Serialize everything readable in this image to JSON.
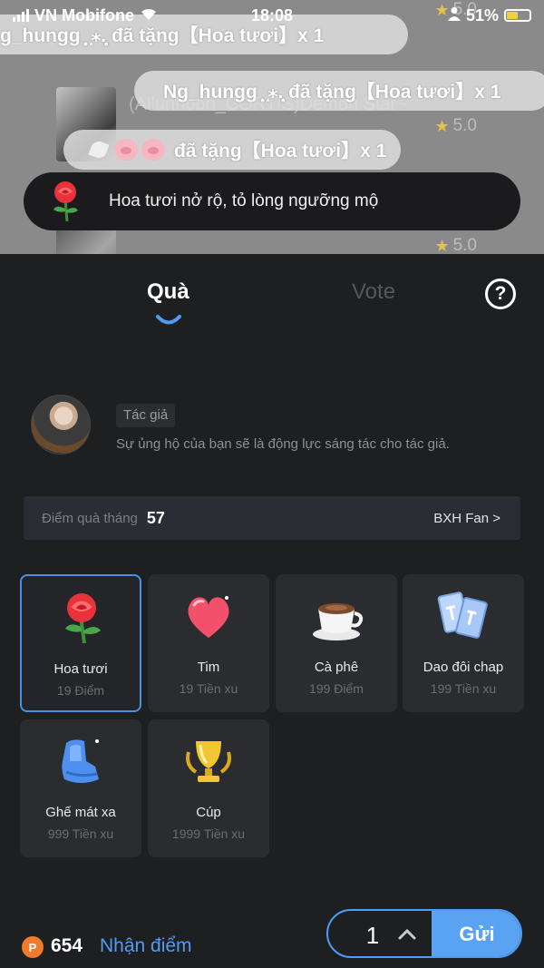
{
  "status_bar": {
    "carrier": "VN Mobifone",
    "time": "18:08",
    "battery": "51%",
    "battery_level": 0.51
  },
  "background": {
    "rating_top": "5.0",
    "title": "(Allunhbon_CORTIS)Demon Star~",
    "rating_1": "5.0",
    "rating_2": "5.0"
  },
  "notifications": [
    {
      "text": "g_hungg ̥͙ ͙⁎.̥͙ đã tặng【Hoa tươi】x 1"
    },
    {
      "text": "Ng_hungg ̥͙ ͙⁎.̥͙ đã tặng【Hoa tươi】x 1"
    },
    {
      "text": "đã tặng【Hoa tươi】x 1"
    }
  ],
  "toast": {
    "text": "Hoa tươi nở rộ, tỏ lòng ngưỡng mộ",
    "icon": "rose-icon"
  },
  "tabs": [
    {
      "label": "Quà",
      "active": true
    },
    {
      "label": "Vote",
      "active": false
    }
  ],
  "help": {
    "label": "?"
  },
  "author": {
    "tag": "Tác giả",
    "description": "Sự ủng hộ của bạn sẽ là động lực sáng tác cho tác giả."
  },
  "points": {
    "label": "Điểm quà tháng",
    "value": "57",
    "rank_link": "BXH Fan >"
  },
  "gifts": [
    {
      "name": "Hoa tươi",
      "price": "19 Điểm",
      "icon": "rose-icon",
      "selected": true
    },
    {
      "name": "Tim",
      "price": "19 Tiền xu",
      "icon": "heart-icon",
      "selected": false
    },
    {
      "name": "Cà phê",
      "price": "199 Điểm",
      "icon": "coffee-icon",
      "selected": false
    },
    {
      "name": "Dao đôi chap",
      "price": "199 Tiền xu",
      "icon": "cards-icon",
      "selected": false
    },
    {
      "name": "Ghế mát xa",
      "price": "999 Tiền xu",
      "icon": "massage-chair-icon",
      "selected": false
    },
    {
      "name": "Cúp",
      "price": "1999 Tiền xu",
      "icon": "trophy-icon",
      "selected": false
    }
  ],
  "wallet": {
    "coin_symbol": "P",
    "balance": "654",
    "earn_label": "Nhận điểm"
  },
  "send": {
    "quantity": "1",
    "button_label": "Gửi"
  },
  "colors": {
    "accent": "#4f9df3",
    "selected_border": "#4a8fe6",
    "coin": "#f07b2c",
    "star": "#e7c24a"
  }
}
